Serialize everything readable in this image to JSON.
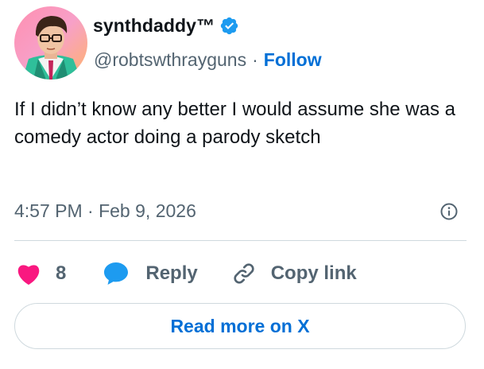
{
  "author": {
    "display_name": "synthdaddy™",
    "handle": "@robtswthrayguns",
    "separator": "·",
    "follow_label": "Follow",
    "verified": true
  },
  "tweet": {
    "text": "If I didn’t know any better I would assume she was a comedy actor doing a parody sketch",
    "timestamp": "4:57 PM · Feb 9, 2026"
  },
  "actions": {
    "like_count": "8",
    "reply_label": "Reply",
    "copy_link_label": "Copy link"
  },
  "read_more_label": "Read more on X",
  "colors": {
    "link_blue": "#006fd6",
    "verified_blue": "#1d9bf0",
    "heart_pink": "#f91880",
    "secondary_text": "#536471",
    "divider": "#cfd9de"
  },
  "icons": {
    "verified": "verified-badge-icon",
    "like": "heart-icon",
    "reply": "speech-bubble-icon",
    "copy": "link-icon",
    "info": "info-icon"
  }
}
